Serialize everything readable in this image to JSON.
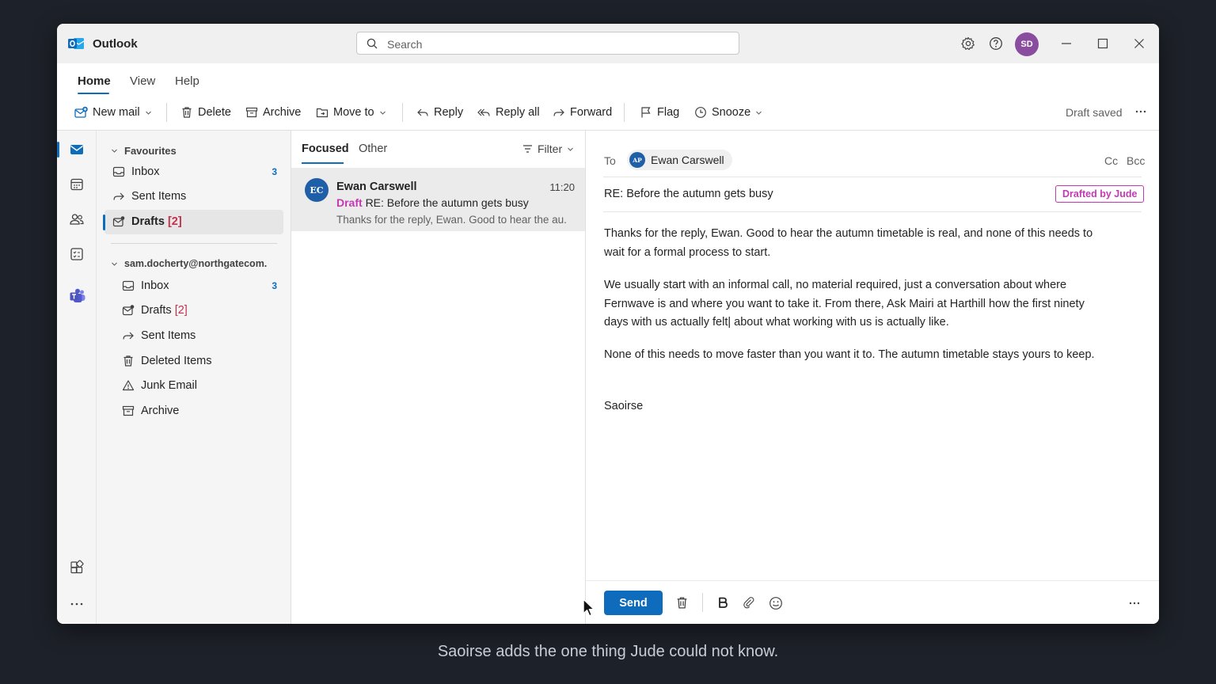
{
  "app": {
    "title": "Outlook",
    "brand_color": "#0f6cbd"
  },
  "search": {
    "placeholder": "Search"
  },
  "titlebar": {
    "avatar_initials": "SD",
    "avatar_color": "#8a4c9e"
  },
  "ribbon": {
    "tabs": [
      {
        "label": "Home",
        "active": true
      },
      {
        "label": "View"
      },
      {
        "label": "Help"
      }
    ],
    "toolbar": {
      "new_mail": "New mail",
      "delete": "Delete",
      "archive": "Archive",
      "move_to": "Move to",
      "reply": "Reply",
      "reply_all": "Reply all",
      "forward": "Forward",
      "flag": "Flag",
      "snooze": "Snooze",
      "status": "Draft saved"
    }
  },
  "folders": {
    "favourites": {
      "heading": "Favourites",
      "items": [
        {
          "label": "Inbox",
          "count": "3"
        },
        {
          "label": "Sent Items"
        },
        {
          "label": "Drafts",
          "count": "[2]",
          "selected": true
        }
      ]
    },
    "account": {
      "heading": "sam.docherty@northgatecom.",
      "items": [
        {
          "label": "Inbox",
          "count": "3"
        },
        {
          "label": "Drafts",
          "count": "[2]"
        },
        {
          "label": "Sent Items"
        },
        {
          "label": "Deleted Items"
        },
        {
          "label": "Junk Email"
        },
        {
          "label": "Archive"
        }
      ]
    }
  },
  "message_list": {
    "tabs": [
      {
        "label": "Focused",
        "active": true
      },
      {
        "label": "Other"
      }
    ],
    "filter_label": "Filter",
    "messages": [
      {
        "initials": "EC",
        "sender": "Ewan Carswell",
        "time": "11:20",
        "draft_tag": "Draft",
        "subject": "RE: Before the autumn gets busy",
        "preview": "Thanks for the reply, Ewan. Good to hear the au."
      }
    ]
  },
  "compose": {
    "to_label": "To",
    "recipient": {
      "initials": "AP",
      "name": "Ewan Carswell"
    },
    "cc_label": "Cc",
    "bcc_label": "Bcc",
    "subject": "RE: Before the autumn gets busy",
    "badge": "Drafted by Jude",
    "badge_color": "#c239b3",
    "body": [
      "Thanks for the reply, Ewan. Good to hear the autumn timetable is real, and none of this needs to wait for a formal process to start.",
      "We usually start with an informal call, no material required, just a conversation about where Fernwave is and where you want to take it. From there, Ask Mairi at Harthill how the first ninety days with us actually felt| about what working with us is actually like.",
      "None of this needs to move faster than you want it to. The autumn timetable stays yours to keep.",
      "Saoirse"
    ],
    "send_label": "Send"
  },
  "caption": "Saoirse adds the one thing Jude could not know."
}
